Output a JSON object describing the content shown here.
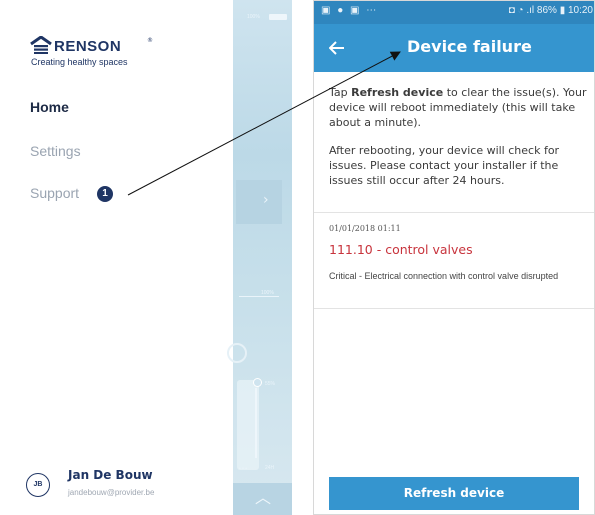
{
  "left_screen": {
    "status": {
      "battery_percent": "100%"
    },
    "logo": {
      "brand": "RENSON",
      "registered": "®",
      "tagline": "Creating healthy spaces"
    },
    "menu": {
      "home": "Home",
      "settings": "Settings",
      "support": "Support",
      "support_badge": "1"
    },
    "background_peek": {
      "level_high": "100%",
      "level_mid": "55%",
      "level_time": "24H",
      "chevron": "›"
    },
    "user": {
      "initials": "JB",
      "name": "Jan De Bouw",
      "email": "jandebouw@provider.be"
    }
  },
  "right_screen": {
    "status_bar": {
      "left_icons": "▣ ● ▣ ⋯",
      "right": "◘ ◔ .ıl 86% ▮ 10:20"
    },
    "title": "Device failure",
    "intro": {
      "p1_before": "Tap ",
      "p1_bold": "Refresh device",
      "p1_after": " to clear the issue(s). Your device will reboot immediately (this will take about a minute).",
      "p2": "After rebooting, your device will check for issues. Please contact your installer if the issues still occur after 24 hours."
    },
    "issue": {
      "timestamp": "01/01/2018 01:11",
      "title": "111.10 - control valves",
      "description": "Critical - Electrical connection with control valve disrupted"
    },
    "refresh_button": "Refresh device"
  },
  "colors": {
    "brand_navy": "#1f3564",
    "app_blue": "#3595cf",
    "status_blue": "#2f86be",
    "error_red": "#c8343d"
  }
}
